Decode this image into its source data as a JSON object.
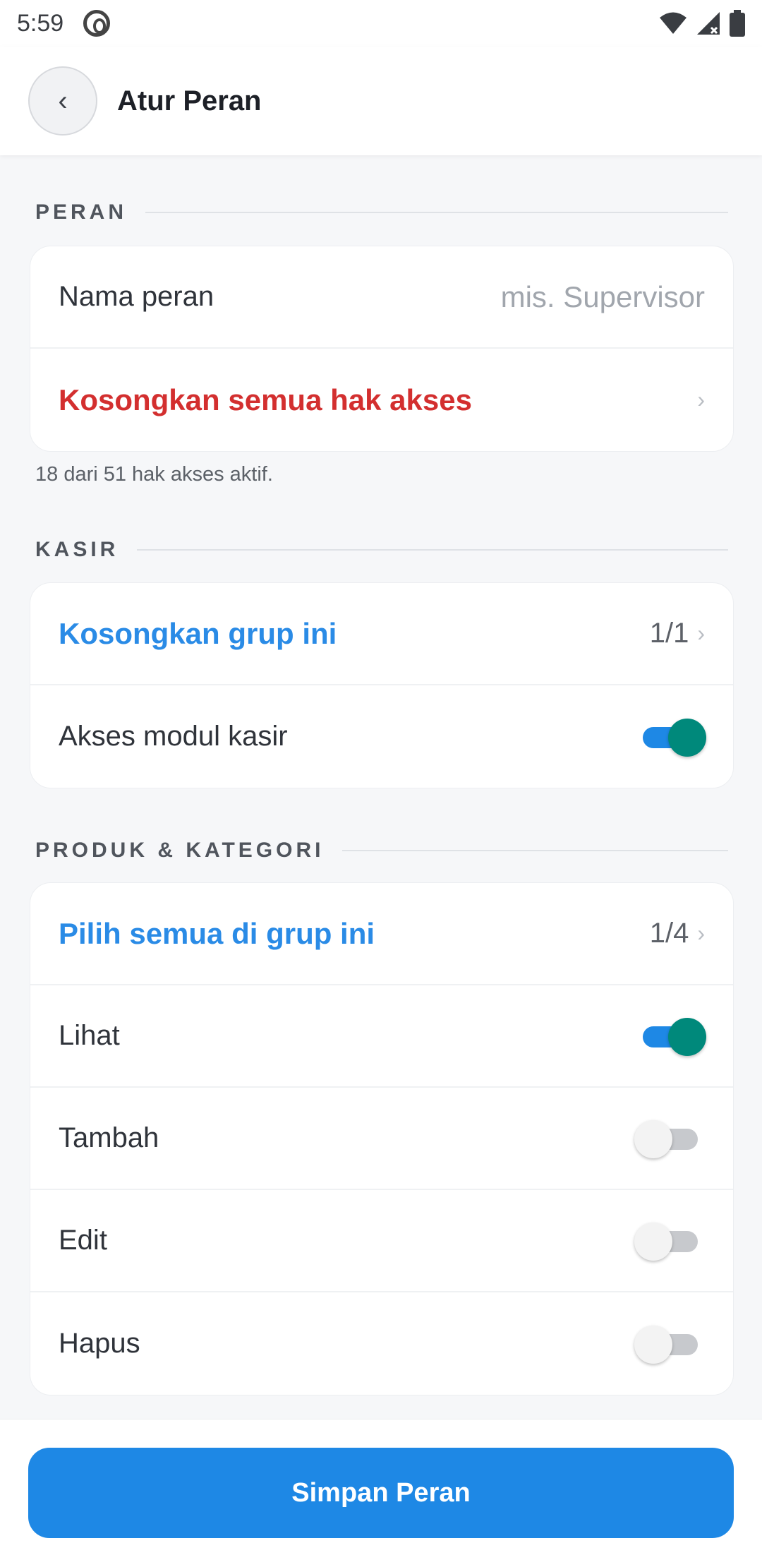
{
  "status_bar": {
    "time": "5:59"
  },
  "header": {
    "back_symbol": "‹",
    "title": "Atur Peran"
  },
  "section_peran": {
    "title": "PERAN",
    "name_label": "Nama peran",
    "name_placeholder": "mis. Supervisor",
    "clear_all_label": "Kosongkan semua hak akses",
    "helper_text": "18 dari 51 hak akses aktif."
  },
  "section_kasir": {
    "title": "KASIR",
    "group_action_label": "Kosongkan grup ini",
    "group_count": "1/1",
    "items": [
      {
        "label": "Akses modul kasir",
        "enabled": true
      }
    ]
  },
  "section_produk": {
    "title": "PRODUK & KATEGORI",
    "group_action_label": "Pilih semua di grup ini",
    "group_count": "1/4",
    "items": [
      {
        "label": "Lihat",
        "enabled": true
      },
      {
        "label": "Tambah",
        "enabled": false
      },
      {
        "label": "Edit",
        "enabled": false
      },
      {
        "label": "Hapus",
        "enabled": false
      }
    ]
  },
  "footer": {
    "save_label": "Simpan Peran"
  },
  "colors": {
    "accent": "#1e88e5",
    "toggle_on_thumb": "#00897b",
    "danger": "#d32f2f",
    "link": "#2a8be6"
  }
}
